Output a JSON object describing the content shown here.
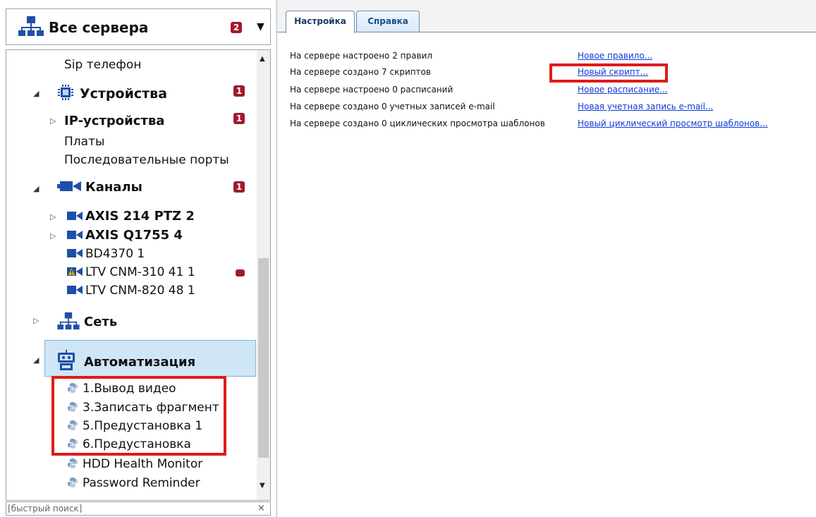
{
  "server_selector": {
    "title": "Все сервера",
    "badge": "2",
    "icon": "network-icon",
    "dropdown_icon": "triangle-down-icon"
  },
  "tree": {
    "sip": "Sip телефон",
    "devices": {
      "label": "Устройства",
      "badge": "1",
      "icon": "chip-icon"
    },
    "ip_devices": {
      "label": "IP-устройства",
      "badge": "1"
    },
    "boards": "Платы",
    "serial_ports": "Последовательные порты",
    "channels": {
      "label": "Каналы",
      "badge": "1",
      "icon": "camera-icon"
    },
    "cameras": [
      {
        "label": "AXIS 214 PTZ 2",
        "bold": true,
        "expandable": true
      },
      {
        "label": "AXIS Q1755 4",
        "bold": true,
        "expandable": true
      },
      {
        "label": "BD4370 1",
        "bold": false,
        "expandable": false
      },
      {
        "label": "LTV CNM-310 41 1",
        "bold": false,
        "expandable": false,
        "warning": true
      },
      {
        "label": "LTV CNM-820 48 1",
        "bold": false,
        "expandable": false
      }
    ],
    "network": {
      "label": "Сеть",
      "icon": "network-icon"
    },
    "automation": {
      "label": "Автоматизация",
      "icon": "robot-icon"
    },
    "scripts": [
      "1.Вывод видео",
      "3.Записать фрагмент",
      "5.Предустановка 1",
      "6.Предустановка",
      "HDD Health Monitor",
      "Password Reminder"
    ],
    "colors": {
      "badge": "#a11a2b",
      "selection": "#cfe6f6",
      "highlight_box": "#e01a1a"
    }
  },
  "search": {
    "placeholder": "[быстрый поиск]",
    "clear": "×"
  },
  "tabs": [
    {
      "label": "Настройка",
      "active": true
    },
    {
      "label": "Справка",
      "active": false
    }
  ],
  "info_lines": [
    {
      "text": "На сервере настроено 2 правил",
      "link": "Новое правило..."
    },
    {
      "text": "На сервере создано 7 скриптов",
      "link": "Новый скрипт..."
    },
    {
      "text": "На сервере настроено 0 расписаний",
      "link": "Новое расписание..."
    },
    {
      "text": "На сервере создано 0 учетных записей e-mail",
      "link": "Новая учетная запись e-mail..."
    },
    {
      "text": "На сервере создано 0 циклических просмотра шаблонов",
      "link": "Новый циклический просмотр шаблонов..."
    }
  ],
  "link_color": "#0b3ad6"
}
